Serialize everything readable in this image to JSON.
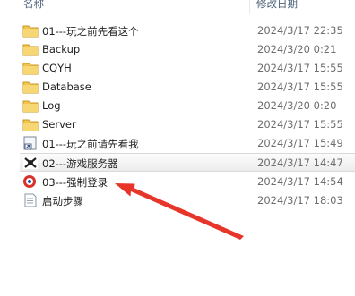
{
  "header": {
    "name": "名称",
    "date_modified": "修改日期"
  },
  "files": [
    {
      "name": "01---玩之前先看这个",
      "date": "2024/3/17 22:35",
      "icon": "folder-icon"
    },
    {
      "name": "Backup",
      "date": "2024/3/20 0:21",
      "icon": "folder-icon"
    },
    {
      "name": "CQYH",
      "date": "2024/3/17 15:55",
      "icon": "folder-icon"
    },
    {
      "name": "Database",
      "date": "2024/3/17 15:55",
      "icon": "folder-icon"
    },
    {
      "name": "Log",
      "date": "2024/3/20 0:20",
      "icon": "folder-icon"
    },
    {
      "name": "Server",
      "date": "2024/3/17 15:55",
      "icon": "folder-icon"
    },
    {
      "name": "01---玩之前请先看我",
      "date": "2024/3/17 15:49",
      "icon": "shortcut-icon"
    },
    {
      "name": "02---游戏服务器",
      "date": "2024/3/17 14:47",
      "icon": "game-server-icon"
    },
    {
      "name": "03---强制登录",
      "date": "2024/3/17 14:54",
      "icon": "login-app-icon"
    },
    {
      "name": "启动步骤",
      "date": "2024/3/17 18:03",
      "icon": "text-file-icon"
    }
  ],
  "colors": {
    "annotation_arrow": "#e8352a",
    "highlight_row": "#ececec"
  }
}
